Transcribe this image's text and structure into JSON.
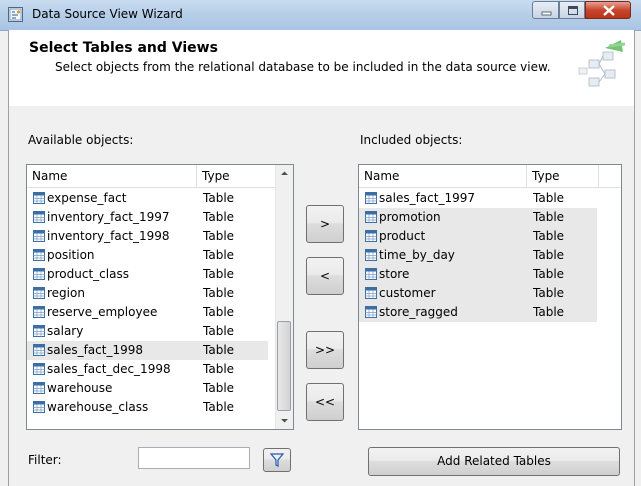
{
  "window": {
    "title": "Data Source View Wizard",
    "icon": "wizard-app-icon",
    "controls": [
      "minimize-icon",
      "maximize-icon",
      "close-icon"
    ]
  },
  "header": {
    "title": "Select Tables and Views",
    "subtitle": "Select objects from the relational database to be included in the data source view."
  },
  "available": {
    "label": "Available objects:",
    "columns": [
      "Name",
      "Type"
    ],
    "rows": [
      {
        "name": "expense_fact",
        "type": "Table"
      },
      {
        "name": "inventory_fact_1997",
        "type": "Table"
      },
      {
        "name": "inventory_fact_1998",
        "type": "Table"
      },
      {
        "name": "position",
        "type": "Table"
      },
      {
        "name": "product_class",
        "type": "Table"
      },
      {
        "name": "region",
        "type": "Table"
      },
      {
        "name": "reserve_employee",
        "type": "Table"
      },
      {
        "name": "salary",
        "type": "Table"
      },
      {
        "name": "sales_fact_1998",
        "type": "Table"
      },
      {
        "name": "sales_fact_dec_1998",
        "type": "Table"
      },
      {
        "name": "warehouse",
        "type": "Table"
      },
      {
        "name": "warehouse_class",
        "type": "Table"
      }
    ],
    "selected_row": "sales_fact_1998"
  },
  "included": {
    "label": "Included objects:",
    "columns": [
      "Name",
      "Type"
    ],
    "rows": [
      {
        "name": "sales_fact_1997",
        "type": "Table"
      },
      {
        "name": "promotion",
        "type": "Table"
      },
      {
        "name": "product",
        "type": "Table"
      },
      {
        "name": "time_by_day",
        "type": "Table"
      },
      {
        "name": "store",
        "type": "Table"
      },
      {
        "name": "customer",
        "type": "Table"
      },
      {
        "name": "store_ragged",
        "type": "Table"
      }
    ]
  },
  "transfer_buttons": {
    "add": ">",
    "remove": "<",
    "add_all": ">>",
    "remove_all": "<<"
  },
  "filter": {
    "label": "Filter:",
    "value": "",
    "icon": "filter-funnel-icon"
  },
  "add_related_label": "Add Related Tables",
  "colors": {
    "titlebar": "#b7cfe9",
    "selected_row": "#e8e8e8",
    "included_row": "#e8e8e8",
    "table_icon": "#3a6ea5"
  }
}
